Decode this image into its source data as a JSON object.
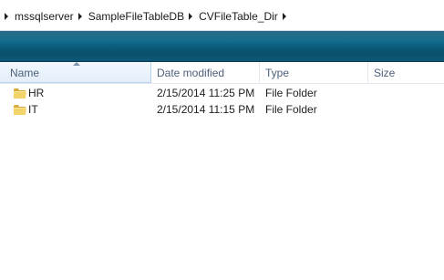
{
  "breadcrumb": {
    "items": [
      "mssqlserver",
      "SampleFileTableDB",
      "CVFileTable_Dir"
    ]
  },
  "columns": {
    "name": "Name",
    "date_modified": "Date modified",
    "type": "Type",
    "size": "Size"
  },
  "rows": [
    {
      "name": "HR",
      "date_modified": "2/15/2014 11:25 PM",
      "type": "File Folder",
      "size": "",
      "icon": "folder-icon"
    },
    {
      "name": "IT",
      "date_modified": "2/15/2014 11:15 PM",
      "type": "File Folder",
      "size": "",
      "icon": "folder-icon"
    }
  ],
  "colors": {
    "toolbar": "#0e6a8c",
    "header_text": "#4c607a",
    "folder": "#e8c24e"
  }
}
